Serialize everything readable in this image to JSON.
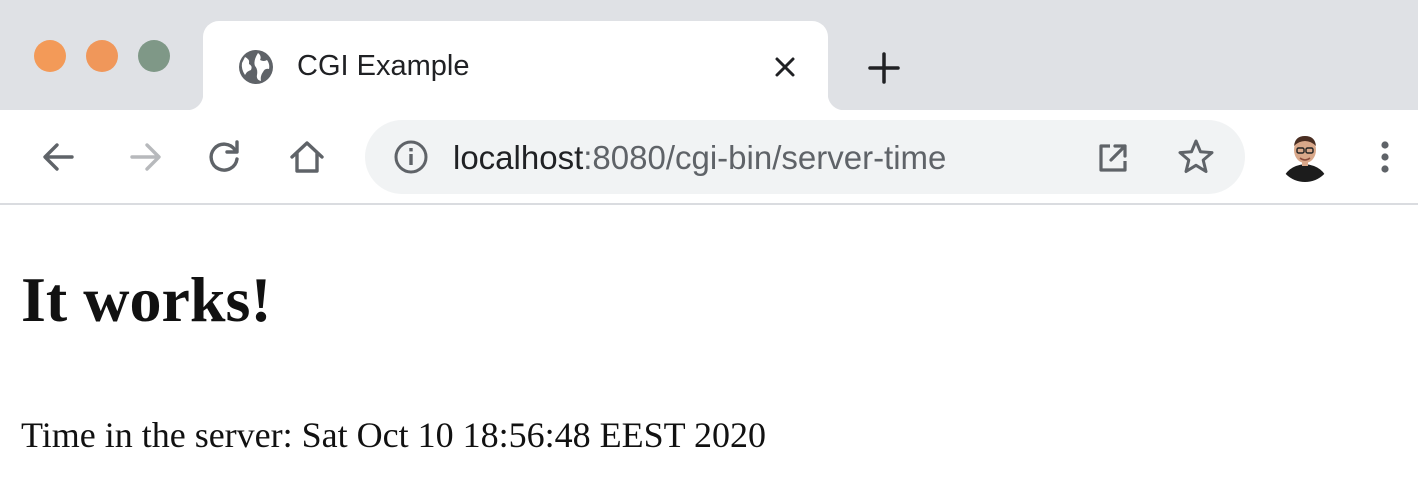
{
  "window_controls": {
    "colors": {
      "close": "#f39a58",
      "minimize": "#f0975a",
      "maximize": "#7f9887"
    }
  },
  "tab": {
    "title": "CGI Example",
    "favicon": "globe-icon",
    "close_icon": "close-icon"
  },
  "new_tab_icon": "plus-icon",
  "toolbar": {
    "icons": {
      "back": "arrow-left-icon",
      "forward": "arrow-right-icon",
      "reload": "reload-icon",
      "home": "home-icon",
      "site_info": "info-icon",
      "open_in": "external-link-icon",
      "bookmark": "star-icon",
      "menu": "kebab-menu-icon"
    },
    "forward_enabled": false
  },
  "address_bar": {
    "host": "localhost",
    "rest": ":8080/cgi-bin/server-time"
  },
  "page": {
    "heading": "It works!",
    "server_time": "Time in the server: Sat Oct 10 18:56:48 EEST 2020"
  },
  "colors": {
    "tabstrip_bg": "#dfe1e5",
    "omnibox_bg": "#f1f3f4",
    "icon": "#5f6368",
    "icon_disabled": "#b7b9bc",
    "text": "#202124"
  }
}
